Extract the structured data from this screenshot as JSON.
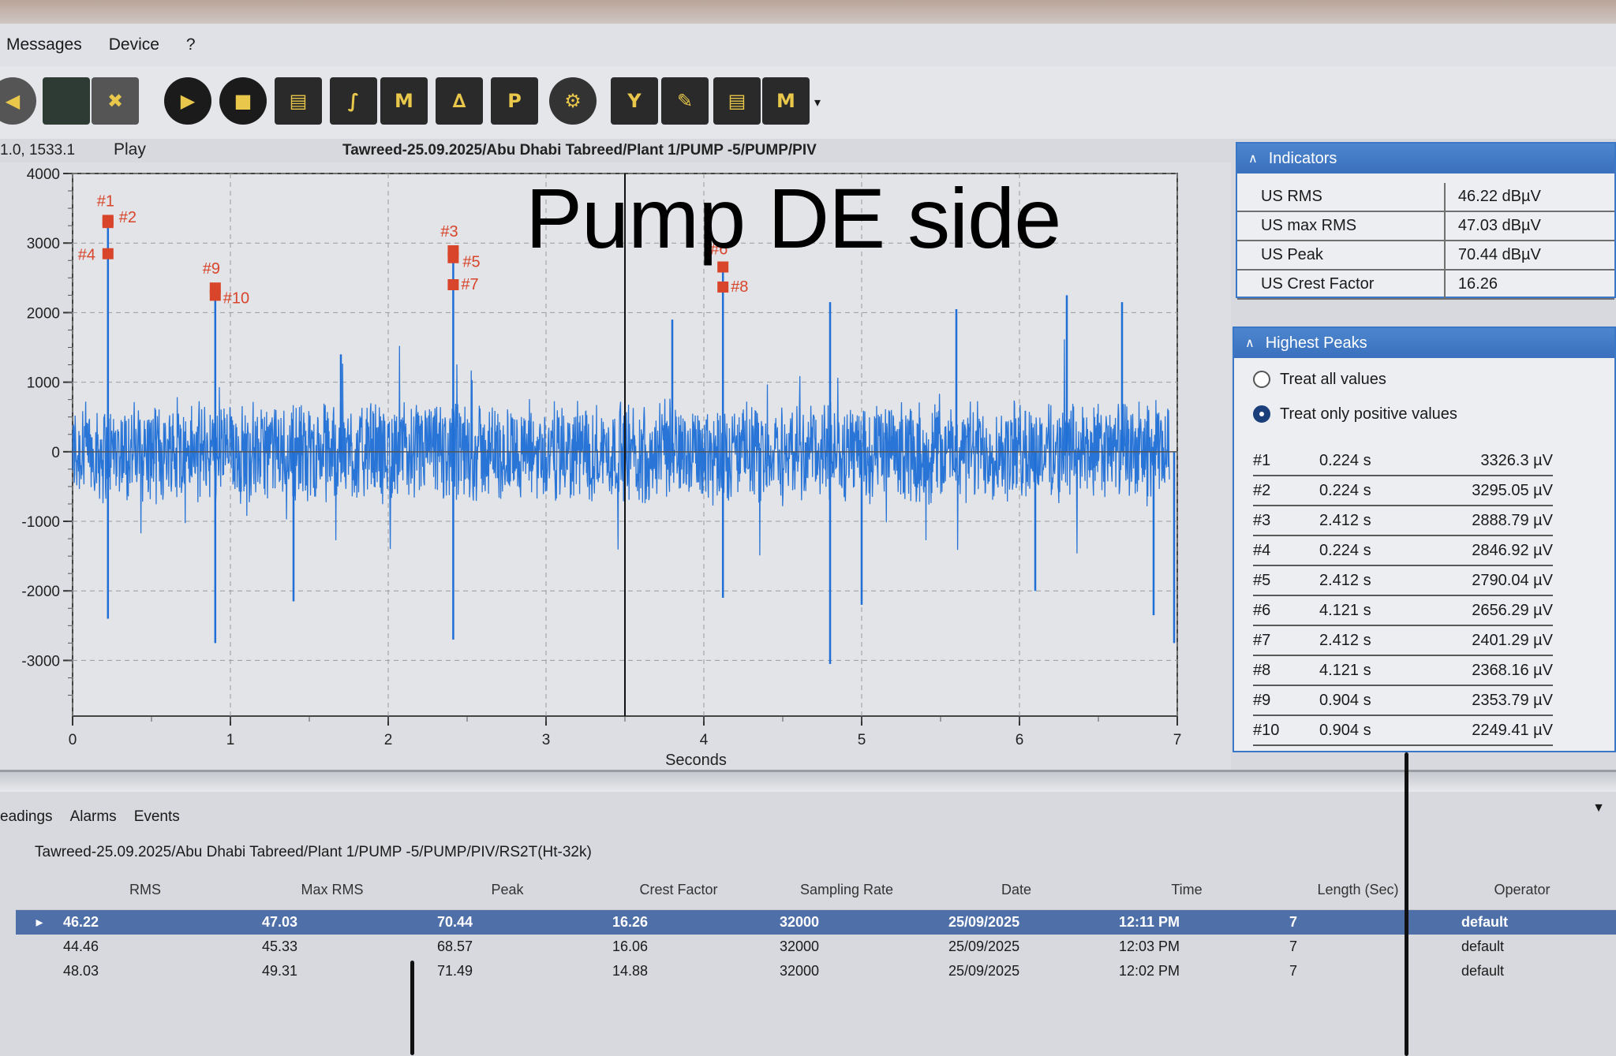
{
  "menu": [
    "Messages",
    "Device",
    "?"
  ],
  "status": {
    "coords": "1.0, 1533.1",
    "play_label": "Play",
    "path": "Tawreed-25.09.2025/Abu Dhabi Tabreed/Plant 1/PUMP -5/PUMP/PIV"
  },
  "overlay_title": "Pump DE side",
  "chart_data": {
    "type": "line",
    "title": "",
    "xlabel": "Seconds",
    "ylabel": "",
    "xlim": [
      0,
      7
    ],
    "ylim": [
      -3800,
      4000
    ],
    "x_ticks": [
      "0",
      "1",
      "2",
      "3",
      "4",
      "5",
      "6",
      "7"
    ],
    "y_ticks": [
      "4000",
      "3000",
      "2000",
      "1000",
      "0",
      "-1000",
      "-2000",
      "-3000"
    ],
    "cursor_x": 3.5,
    "markers": [
      {
        "label": "#1",
        "x": 0.224,
        "y": 3326.3
      },
      {
        "label": "#2",
        "x": 0.224,
        "y": 3295.05
      },
      {
        "label": "#3",
        "x": 2.412,
        "y": 2888.79
      },
      {
        "label": "#4",
        "x": 0.224,
        "y": 2846.92
      },
      {
        "label": "#5",
        "x": 2.412,
        "y": 2790.04
      },
      {
        "label": "#6",
        "x": 4.121,
        "y": 2656.29
      },
      {
        "label": "#7",
        "x": 2.412,
        "y": 2401.29
      },
      {
        "label": "#8",
        "x": 4.121,
        "y": 2368.16
      },
      {
        "label": "#9",
        "x": 0.904,
        "y": 2353.79
      },
      {
        "label": "#10",
        "x": 0.904,
        "y": 2249.41
      }
    ],
    "spikes": [
      {
        "x": 0.224,
        "y": 3326
      },
      {
        "x": 0.224,
        "y": -2400
      },
      {
        "x": 0.904,
        "y": 2354
      },
      {
        "x": 0.904,
        "y": -2750
      },
      {
        "x": 2.412,
        "y": 2889
      },
      {
        "x": 2.412,
        "y": -2700
      },
      {
        "x": 4.121,
        "y": 2656
      },
      {
        "x": 4.121,
        "y": -2100
      },
      {
        "x": 1.7,
        "y": 1400
      },
      {
        "x": 1.4,
        "y": -2150
      },
      {
        "x": 3.8,
        "y": 1900
      },
      {
        "x": 4.8,
        "y": 2150
      },
      {
        "x": 4.8,
        "y": -3050
      },
      {
        "x": 5.6,
        "y": 2050
      },
      {
        "x": 6.3,
        "y": 2250
      },
      {
        "x": 6.65,
        "y": 2150
      },
      {
        "x": 6.85,
        "y": -2350
      },
      {
        "x": 6.98,
        "y": -2750
      },
      {
        "x": 5.0,
        "y": -2200
      },
      {
        "x": 6.1,
        "y": -2000
      }
    ],
    "series_color": "#1f6fd6",
    "marker_color": "#d8452a"
  },
  "indicators": {
    "title": "Indicators",
    "rows": [
      {
        "label": "US RMS",
        "value": "46.22 dBµV"
      },
      {
        "label": "US max RMS",
        "value": "47.03 dBµV"
      },
      {
        "label": "US Peak",
        "value": "70.44 dBµV"
      },
      {
        "label": "US Crest Factor",
        "value": "16.26"
      }
    ]
  },
  "highest_peaks": {
    "title": "Highest Peaks",
    "option_all": "Treat all values",
    "option_positive": "Treat only positive values",
    "rows": [
      {
        "id": "#1",
        "time": "0.224 s",
        "value": "3326.3 µV"
      },
      {
        "id": "#2",
        "time": "0.224 s",
        "value": "3295.05 µV"
      },
      {
        "id": "#3",
        "time": "2.412 s",
        "value": "2888.79 µV"
      },
      {
        "id": "#4",
        "time": "0.224 s",
        "value": "2846.92 µV"
      },
      {
        "id": "#5",
        "time": "2.412 s",
        "value": "2790.04 µV"
      },
      {
        "id": "#6",
        "time": "4.121 s",
        "value": "2656.29 µV"
      },
      {
        "id": "#7",
        "time": "2.412 s",
        "value": "2401.29 µV"
      },
      {
        "id": "#8",
        "time": "4.121 s",
        "value": "2368.16 µV"
      },
      {
        "id": "#9",
        "time": "0.904 s",
        "value": "2353.79 µV"
      },
      {
        "id": "#10",
        "time": "0.904 s",
        "value": "2249.41 µV"
      }
    ]
  },
  "bottom": {
    "tabs": [
      "eadings",
      "Alarms",
      "Events"
    ],
    "path": "Tawreed-25.09.2025/Abu Dhabi Tabreed/Plant 1/PUMP -5/PUMP/PIV/RS2T(Ht-32k)",
    "columns": [
      "RMS",
      "Max RMS",
      "Peak",
      "Crest Factor",
      "Sampling Rate",
      "Date",
      "Time",
      "Length (Sec)",
      "Operator"
    ],
    "rows": [
      [
        "46.22",
        "47.03",
        "70.44",
        "16.26",
        "32000",
        "25/09/2025",
        "12:11 PM",
        "7",
        "default"
      ],
      [
        "44.46",
        "45.33",
        "68.57",
        "16.06",
        "32000",
        "25/09/2025",
        "12:03 PM",
        "7",
        "default"
      ],
      [
        "48.03",
        "49.31",
        "71.49",
        "14.88",
        "32000",
        "25/09/2025",
        "12:02 PM",
        "7",
        "default"
      ]
    ]
  }
}
